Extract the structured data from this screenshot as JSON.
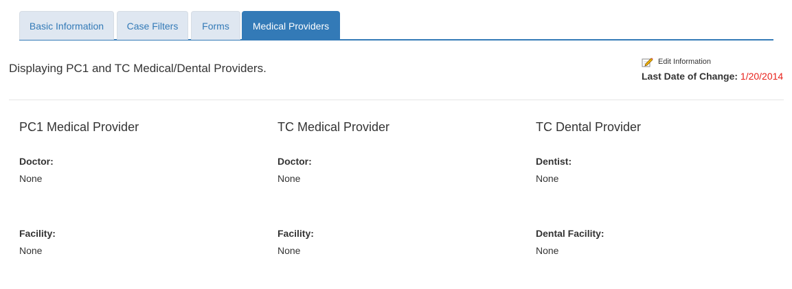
{
  "tabs": [
    {
      "label": "Basic Information",
      "active": false
    },
    {
      "label": "Case Filters",
      "active": false
    },
    {
      "label": "Forms",
      "active": false
    },
    {
      "label": "Medical Providers",
      "active": true
    }
  ],
  "intro_text": "Displaying PC1 and TC Medical/Dental Providers.",
  "edit": {
    "link_label": "Edit Information",
    "icon": "pencil-edit-icon",
    "change_label": "Last Date of Change:",
    "change_date": "1/20/2014"
  },
  "columns": [
    {
      "title": "PC1 Medical Provider",
      "field1_label": "Doctor:",
      "field1_value": "None",
      "field2_label": "Facility:",
      "field2_value": "None"
    },
    {
      "title": "TC Medical Provider",
      "field1_label": "Doctor:",
      "field1_value": "None",
      "field2_label": "Facility:",
      "field2_value": "None"
    },
    {
      "title": "TC Dental Provider",
      "field1_label": "Dentist:",
      "field1_value": "None",
      "field2_label": "Dental Facility:",
      "field2_value": "None"
    }
  ],
  "colors": {
    "accent": "#337ab7",
    "tab_inactive_bg": "#dfe7f1",
    "date_red": "#e8211a"
  }
}
